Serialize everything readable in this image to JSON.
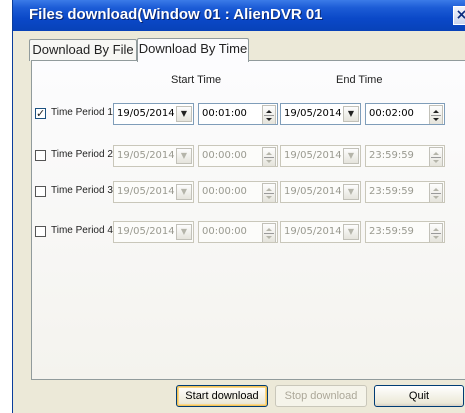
{
  "window": {
    "title": "Files download(Window 01 : AlienDVR 01",
    "close_glyph": "×"
  },
  "tabs": [
    {
      "label": "Download By File",
      "active": false
    },
    {
      "label": "Download By Time",
      "active": true
    }
  ],
  "headers": {
    "start_time": "Start Time",
    "end_time": "End Time"
  },
  "periods": [
    {
      "label": "Time Period 1",
      "checked": true,
      "enabled": true,
      "start_date": "19/05/2014",
      "start_time": "00:01:00",
      "end_date": "19/05/2014",
      "end_time": "00:02:00"
    },
    {
      "label": "Time Period 2",
      "checked": false,
      "enabled": false,
      "start_date": "19/05/2014",
      "start_time": "00:00:00",
      "end_date": "19/05/2014",
      "end_time": "23:59:59"
    },
    {
      "label": "Time Period 3",
      "checked": false,
      "enabled": false,
      "start_date": "19/05/2014",
      "start_time": "00:00:00",
      "end_date": "19/05/2014",
      "end_time": "23:59:59"
    },
    {
      "label": "Time Period 4",
      "checked": false,
      "enabled": false,
      "start_date": "19/05/2014",
      "start_time": "00:00:00",
      "end_date": "19/05/2014",
      "end_time": "23:59:59"
    }
  ],
  "buttons": {
    "start": "Start download",
    "stop": "Stop download",
    "quit": "Quit"
  },
  "colors": {
    "titlebar": "#0a48c8",
    "dialog_bg": "#ece9d8",
    "disabled_text": "#9a9a90"
  }
}
